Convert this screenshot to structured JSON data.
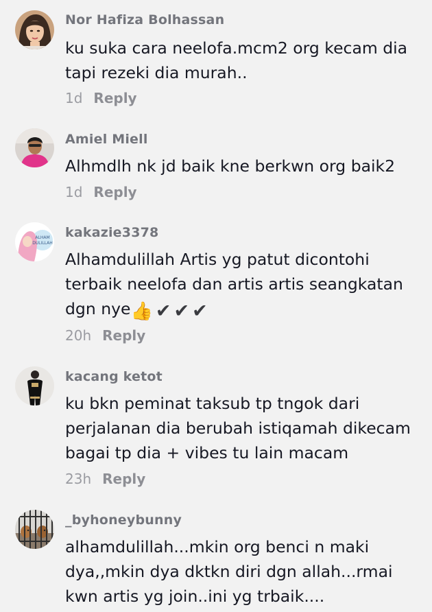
{
  "comments": [
    {
      "username": "Nor Hafiza Bolhassan",
      "lines": [
        "ku suka cara neelofa.mcm2 org kecam dia",
        "tapi rezeki dia murah.."
      ],
      "time": "1d",
      "reply": "Reply",
      "avatar_icon": "woman-portrait-avatar"
    },
    {
      "username": "Amiel Miell",
      "lines": [
        "Alhmdlh nk jd baik kne berkwn org baik2"
      ],
      "time": "1d",
      "reply": "Reply",
      "avatar_icon": "man-pink-shirt-avatar"
    },
    {
      "username": "kakazie3378",
      "lines": [
        "Alhamdulillah Artis yg patut dicontohi",
        "terbaik neelofa dan artis artis seangkatan",
        "dgn nye"
      ],
      "emojis": [
        "👍",
        "✔",
        "✔",
        "✔"
      ],
      "avatar_text": "ALHAM DULILLAH",
      "time": "20h",
      "reply": "Reply",
      "avatar_icon": "hijab-cartoon-avatar"
    },
    {
      "username": "kacang ketot",
      "lines": [
        "ku bkn peminat taksub tp tngok dari",
        "perjalanan dia berubah istiqamah dikecam",
        "bagai tp dia + vibes tu lain macam"
      ],
      "time": "23h",
      "reply": "Reply",
      "avatar_icon": "person-black-outfit-avatar"
    },
    {
      "username": "_byhoneybunny",
      "lines": [
        "alhamdulillah...mkin org benci n maki",
        "dya,,mkin dya dktkn diri dgn allah...rmai",
        "kwn artis yg join..ini yg trbaik...."
      ],
      "avatar_icon": "pets-in-cage-avatar"
    }
  ],
  "colors": {
    "background": "#f2f2f2",
    "username": "#73757c",
    "text": "#161823",
    "meta": "#9a9ba1"
  }
}
